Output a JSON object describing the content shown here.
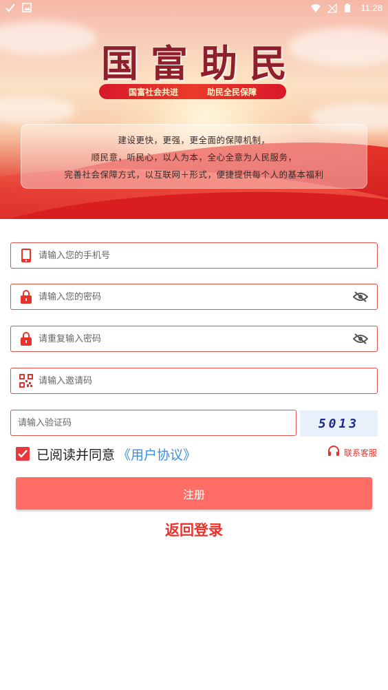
{
  "status_bar": {
    "time": "11:28",
    "left_icons": [
      "check-icon",
      "image-icon"
    ],
    "right_icons": [
      "wifi-icon",
      "no-signal-icon",
      "battery-icon"
    ]
  },
  "banner": {
    "title": "国富助民",
    "slogan_left": "国富社会共进",
    "slogan_right": "助民全民保障",
    "info_lines": [
      "建设更快，更强，更全面的保障机制，",
      "顺民意，听民心，以人为本，全心全意为人民服务，",
      "完善社会保障方式，以互联网＋形式，便捷提供每个人的基本福利"
    ]
  },
  "form": {
    "phone": {
      "placeholder": "请输入您的手机号",
      "value": "",
      "icon": "phone-icon"
    },
    "password": {
      "placeholder": "请输入您的密码",
      "value": "",
      "icon": "lock-icon",
      "toggle_icon": "eye-off-icon"
    },
    "password_confirm": {
      "placeholder": "请重复输入密码",
      "value": "",
      "icon": "lock-icon",
      "toggle_icon": "eye-off-icon"
    },
    "invite_code": {
      "placeholder": "请输入邀请码",
      "value": "",
      "icon": "qr-code-icon"
    },
    "captcha_input": {
      "placeholder": "请输入验证码",
      "value": ""
    },
    "captcha_image_text": "5013"
  },
  "agreement": {
    "checked": true,
    "text": "已阅读并同意",
    "link": "《用户协议》"
  },
  "service": {
    "label": "联系客服",
    "icon": "headset-icon"
  },
  "register_button": "注册",
  "back_to_login": "返回登录",
  "colors": {
    "accent": "#e8332c",
    "border": "#e0524e",
    "button": "#ff6d66",
    "link": "#3b8ee0",
    "captcha_text": "#1b2a8c"
  }
}
